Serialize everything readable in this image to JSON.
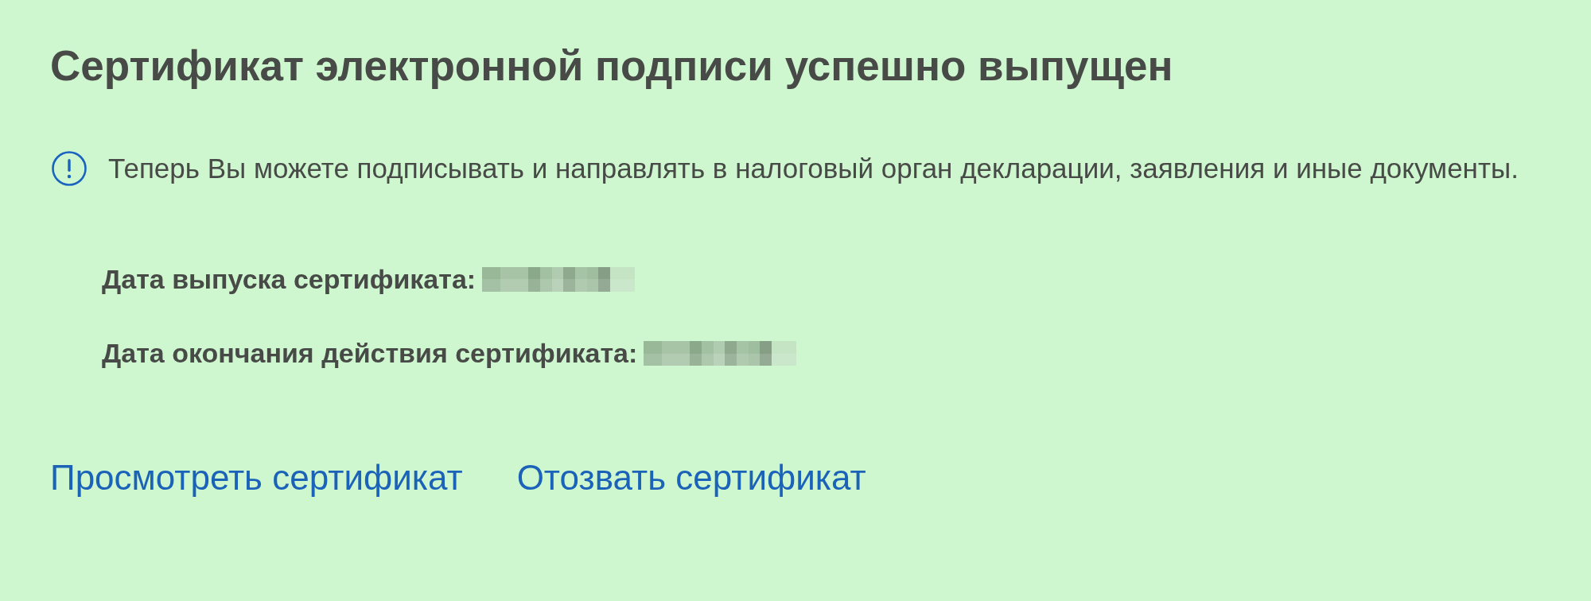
{
  "title": "Сертификат электронной подписи успешно выпущен",
  "notice": {
    "text": "Теперь Вы можете подписывать и направлять в налоговый орган декларации, заявления и иные документы."
  },
  "details": [
    {
      "label": "Дата выпуска сертификата:"
    },
    {
      "label": "Дата окончания действия сертификата:"
    }
  ],
  "links": [
    {
      "label": "Просмотреть сертификат"
    },
    {
      "label": "Отозвать сертификат"
    }
  ]
}
